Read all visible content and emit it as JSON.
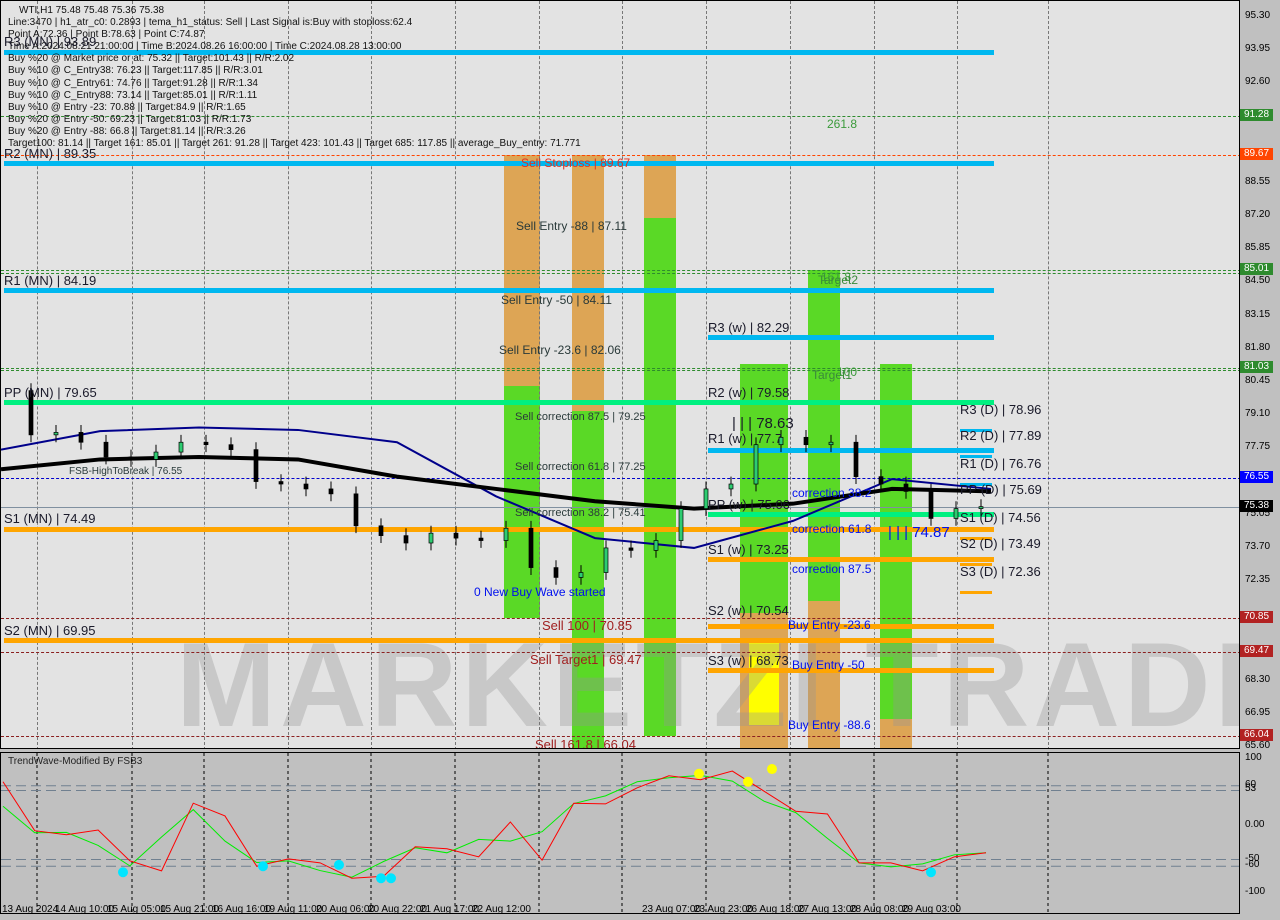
{
  "header": {
    "symbol_line": "WTI,H1  75.48 75.48 75.36 75.38",
    "lines": [
      "Line:3470 | h1_atr_c0: 0.2893 | tema_h1_status: Sell | Last Signal is:Buy with stoploss:62.4",
      "Point A:72.36 | Point B:78.63 | Point C:74.87",
      "Time A:2024.08.21 21:00:00 | Time B:2024.08.26 16:00:00 | Time C:2024.08.28 13:00:00",
      "Buy %20 @ Market price or at: 75.32 || Target:101.43 || R/R:2.02",
      "Buy %10 @ C_Entry38: 76.23 || Target:117.85 || R/R:3.01",
      "Buy %10 @ C_Entry61: 74.76 || Target:91.28 || R/R:1.34",
      "Buy %10 @ C_Entry88: 73.14 || Target:85.01 || R/R:1.11",
      "Buy %10 @ Entry -23: 70.88 || Target:84.9 || R/R:1.65",
      "Buy %20 @ Entry -50: 69.23 || Target:81.03 || R/R:1.73",
      "Buy %20 @ Entry -88: 66.8 || Target:81.14 || R/R:3.26",
      "Target100: 81.14 || Target 161: 85.01 || Target 261: 91.28 || Target 423: 101.43 || Target 685: 117.85 || average_Buy_entry: 71.771"
    ]
  },
  "labels": {
    "r3mn": "R3 (MN) | 93.89",
    "r2mn": "R2 (MN) | 89.35",
    "r1mn": "R1 (MN) | 84.19",
    "ppmn": "PP (MN) | 79.65",
    "s1mn": "S1 (MN) | 74.49",
    "s2mn": "S2 (MN) | 69.95",
    "fsb": "FSB-HighToBreak | 76.55",
    "sell_sl": "Sell Stoploss | 89.67",
    "sell_e88": "Sell Entry -88 | 87.11",
    "sell_e50": "Sell Entry -50 | 84.11",
    "sell_e236": "Sell Entry -23.6 | 82.06",
    "sell_c875": "Sell correction 87.5 | 79.25",
    "sell_c618": "Sell correction 61.8 | 77.25",
    "sell_c382": "Sell correction 38.2 | 75.41",
    "new_wave": "0 New Buy Wave started",
    "sell100": "Sell 100 | 70.85",
    "sell_t1": "Sell Target1 | 69.47",
    "sell1618": "Sell 161.8 | 66.04",
    "t2618": "261.8",
    "t1618": "161.8",
    "target2": "Target2",
    "target1": "Target1",
    "t100": "100",
    "r3w": "R3 (w) | 82.29",
    "r2w": "R2 (w) | 79.58",
    "pointb": "| | | 78.63",
    "r1w": "R1 (w) | 77.7",
    "ppw": "PP (w) | 75.06",
    "s1w": "S1 (w) | 73.25",
    "s2w": "S2 (w) | 70.54",
    "s3w": "S3 (w) | 68.73",
    "c382": "correction 38.2",
    "c618": "correction 61.8",
    "c875": "correction 87.5",
    "pointc": "| | | 74.87",
    "be236": "Buy Entry -23.6",
    "be50": "Buy Entry -50",
    "be886": "Buy Entry -88.6",
    "r3d": "R3 (D) | 78.96",
    "r2d": "R2 (D) | 77.89",
    "r1d": "R1 (D) | 76.76",
    "ppd": "PP (D) | 75.69",
    "s1d": "S1 (D) | 74.56",
    "s2d": "S2 (D) | 73.49",
    "s3d": "S3 (D) | 72.36"
  },
  "watermark": "MARKETZI TRADE",
  "oscillator": {
    "title": "TrendWave-Modified By FSB3",
    "axis": [
      "100",
      "60",
      "53",
      "0.00",
      "-50",
      "-60",
      "-100"
    ]
  },
  "colors": {
    "cyan_level": "#00b8f0",
    "green_level": "#00f080",
    "orange_level": "#ffa500",
    "zone_green": "#5ad926",
    "zone_orange": "#dda555",
    "zone_yellow": "#ffff00",
    "ma_black": "#000000",
    "ma_blue": "#00008b",
    "osc_green": "#00ee00",
    "osc_red": "#ff0000"
  },
  "chart_data": {
    "type": "line",
    "title": "WTI,H1",
    "price_axis": [
      "95.30",
      "93.95",
      "92.60",
      "91.28",
      "89.67",
      "88.55",
      "87.20",
      "85.85",
      "85.01",
      "84.50",
      "83.15",
      "81.80",
      "81.03",
      "80.45",
      "79.10",
      "77.75",
      "76.55",
      "75.38",
      "75.05",
      "73.70",
      "72.35",
      "70.85",
      "69.47",
      "68.30",
      "66.95",
      "66.04",
      "65.60"
    ],
    "ylim": [
      65.6,
      95.3
    ],
    "badges": [
      {
        "value": "91.28",
        "color": "#2e8b2e"
      },
      {
        "value": "89.67",
        "color": "#ff4500"
      },
      {
        "value": "85.01",
        "color": "#2e8b2e"
      },
      {
        "value": "81.03",
        "color": "#2e8b2e"
      },
      {
        "value": "76.55",
        "color": "#0000ff"
      },
      {
        "value": "75.38",
        "color": "#000000"
      },
      {
        "value": "70.85",
        "color": "#b22222"
      },
      {
        "value": "69.47",
        "color": "#b22222"
      },
      {
        "value": "66.04",
        "color": "#b22222"
      }
    ],
    "x_labels": [
      "13 Aug 2024",
      "14 Aug 10:00",
      "15 Aug 05:00",
      "15 Aug 21:00",
      "16 Aug 16:00",
      "19 Aug 11:00",
      "20 Aug 06:00",
      "20 Aug 22:00",
      "21 Aug 17:00",
      "22 Aug 12:00",
      "23 Aug 07:00",
      "23 Aug 23:00",
      "26 Aug 18:00",
      "27 Aug 13:00",
      "28 Aug 08:00",
      "29 Aug 03:00"
    ],
    "close": [
      80.1,
      78.3,
      78.4,
      78.0,
      77.4,
      77.3,
      77.6,
      78.0,
      77.9,
      77.7,
      76.4,
      76.3,
      76.1,
      75.9,
      74.6,
      74.2,
      73.9,
      74.3,
      74.1,
      74.0,
      74.5,
      72.9,
      72.5,
      72.7,
      73.7,
      73.6,
      74.0,
      75.3,
      76.1,
      76.3,
      77.9,
      78.2,
      77.9,
      78.0,
      76.6,
      76.3,
      76.0,
      74.9,
      75.3,
      75.38
    ],
    "ma_black": [
      76.9,
      77.3,
      77.4,
      77.3,
      76.6,
      76.1,
      75.6,
      75.3,
      75.5,
      76.1,
      76.0
    ],
    "ma_blue": [
      77.7,
      78.45,
      78.6,
      78.5,
      78.0,
      75.8,
      74.1,
      73.7,
      74.8,
      76.5,
      76.1
    ],
    "osc_red": [
      66,
      -7,
      -13,
      -6,
      -52,
      -67,
      34,
      15,
      -60,
      -49,
      -55,
      -78,
      -75,
      -31,
      -34,
      -46,
      6,
      -51,
      34,
      33,
      57,
      75,
      69,
      82,
      52,
      22,
      18,
      -55,
      -55,
      -67,
      -46,
      -40
    ],
    "osc_ylim": [
      -100,
      100
    ],
    "osc_levels": [
      60,
      53,
      -50,
      -60
    ]
  }
}
